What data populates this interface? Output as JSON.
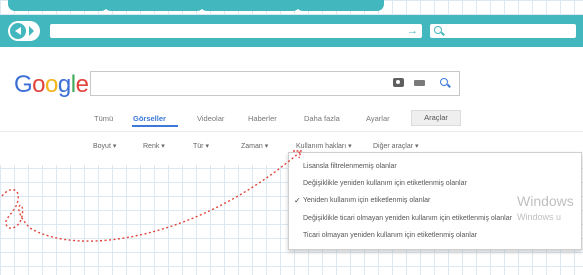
{
  "google": {
    "logo": [
      "G",
      "o",
      "o",
      "g",
      "l",
      "e"
    ]
  },
  "nav_tabs": [
    {
      "label": "Tümü",
      "active": false
    },
    {
      "label": "Görseller",
      "active": true
    },
    {
      "label": "Videolar",
      "active": false
    },
    {
      "label": "Haberler",
      "active": false
    },
    {
      "label": "Daha fazla",
      "active": false
    },
    {
      "label": "Ayarlar",
      "active": false
    }
  ],
  "tools_button": "Araçlar",
  "filters": [
    "Boyut ▾",
    "Renk ▾",
    "Tür ▾",
    "Zaman ▾",
    "Kullanım hakları ▾",
    "Diğer araçlar ▾"
  ],
  "usage_rights_menu": {
    "items": [
      {
        "label": "Lisansla filtrelenmemiş olanlar",
        "checked": false
      },
      {
        "label": "Değişiklikle yeniden kullanım için etiketlenmiş olanlar",
        "checked": false
      },
      {
        "label": "Yeniden kullanım için etiketlenmiş olanlar",
        "checked": true
      },
      {
        "label": "Değişiklikle ticari olmayan yeniden kullanım için etiketlenmiş olanlar",
        "checked": false
      },
      {
        "label": "Ticari olmayan yeniden kullanım için etiketlenmiş olanlar",
        "checked": false
      }
    ],
    "check_mark": "✓"
  },
  "watermark": {
    "line1": "Windows",
    "line2": "Windows u"
  },
  "colors": {
    "browser_accent": "#43b7be",
    "active_tab": "#3c78d8",
    "arrow": "#e0443b"
  }
}
